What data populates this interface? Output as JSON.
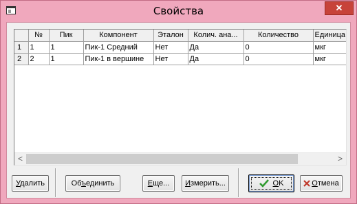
{
  "window": {
    "title": "Свойства",
    "close_symbol": "✕"
  },
  "table": {
    "columns": [
      "№",
      "Пик",
      "Компонент",
      "Эталон",
      "Колич. ана...",
      "Количество",
      "Единица"
    ],
    "rows": [
      {
        "row_num": "1",
        "cells": [
          "1",
          "1",
          "Пик-1 Средний",
          "Нет",
          "Да",
          "0",
          "мкг"
        ]
      },
      {
        "row_num": "2",
        "cells": [
          "2",
          "1",
          "Пик-1 в вершине",
          "Нет",
          "Да",
          "0",
          "мкг"
        ]
      }
    ]
  },
  "scrollbar": {
    "left_arrow": "<",
    "right_arrow": ">"
  },
  "buttons": {
    "delete": {
      "pre": "",
      "u": "У",
      "post": "далить"
    },
    "merge": {
      "pre": "Об",
      "u": "ъ",
      "post": "единить"
    },
    "more": {
      "pre": "",
      "u": "Е",
      "post": "ще..."
    },
    "measure": {
      "pre": "",
      "u": "И",
      "post": "змерить..."
    },
    "ok": {
      "pre": "",
      "u": "O",
      "post": "K"
    },
    "cancel": {
      "pre": "",
      "u": "О",
      "post": "тмена"
    }
  },
  "colors": {
    "title_bar": "#f0a8bd",
    "close_button": "#c7433a",
    "ok_check": "#2f9a2f",
    "cancel_x": "#c0392b"
  },
  "icons": {
    "system_menu": "window-icon",
    "ok": "check-icon",
    "cancel": "x-icon"
  }
}
